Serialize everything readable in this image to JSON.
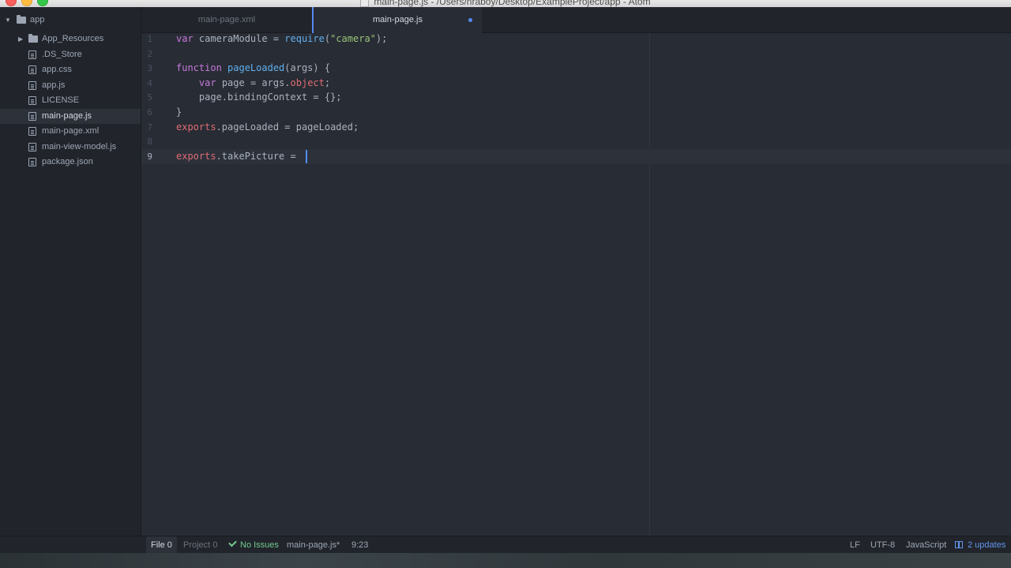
{
  "window": {
    "title": "main-page.js - /Users/nraboy/Desktop/ExampleProject/app - Atom"
  },
  "tree": {
    "root_label": "app",
    "items": [
      {
        "label": "App_Resources",
        "type": "folder"
      },
      {
        "label": ".DS_Store",
        "type": "file"
      },
      {
        "label": "app.css",
        "type": "file"
      },
      {
        "label": "app.js",
        "type": "file"
      },
      {
        "label": "LICENSE",
        "type": "file"
      },
      {
        "label": "main-page.js",
        "type": "file",
        "selected": true
      },
      {
        "label": "main-page.xml",
        "type": "file"
      },
      {
        "label": "main-view-model.js",
        "type": "file"
      },
      {
        "label": "package.json",
        "type": "file"
      }
    ]
  },
  "tabs": [
    {
      "label": "main-page.xml",
      "active": false
    },
    {
      "label": "main-page.js",
      "active": true,
      "modified": true
    }
  ],
  "editor": {
    "line_numbers": [
      "1",
      "2",
      "3",
      "4",
      "5",
      "6",
      "7",
      "8",
      "9"
    ],
    "current_line": "9",
    "lines": [
      [
        {
          "t": "var",
          "c": "kw"
        },
        {
          "t": " cameraModule = ",
          "c": "plain"
        },
        {
          "t": "require",
          "c": "fn"
        },
        {
          "t": "(",
          "c": "plain"
        },
        {
          "t": "\"camera\"",
          "c": "str"
        },
        {
          "t": ");",
          "c": "plain"
        }
      ],
      [],
      [
        {
          "t": "function",
          "c": "kw"
        },
        {
          "t": " ",
          "c": "plain"
        },
        {
          "t": "pageLoaded",
          "c": "fn"
        },
        {
          "t": "(args) {",
          "c": "plain"
        }
      ],
      [
        {
          "t": "    ",
          "c": "plain"
        },
        {
          "t": "var",
          "c": "kw"
        },
        {
          "t": " page = args.",
          "c": "plain"
        },
        {
          "t": "object",
          "c": "obj"
        },
        {
          "t": ";",
          "c": "plain"
        }
      ],
      [
        {
          "t": "    page.bindingContext = {};",
          "c": "plain"
        }
      ],
      [
        {
          "t": "}",
          "c": "plain"
        }
      ],
      [
        {
          "t": "exports",
          "c": "obj"
        },
        {
          "t": ".pageLoaded = pageLoaded;",
          "c": "plain"
        }
      ],
      [],
      [
        {
          "t": "exports",
          "c": "obj"
        },
        {
          "t": ".takePicture = ",
          "c": "plain"
        }
      ]
    ]
  },
  "statusbar": {
    "file_label": "File",
    "file_count": "0",
    "project_label": "Project",
    "project_count": "0",
    "issues": "No Issues",
    "filename": "main-page.js*",
    "cursor_pos": "9:23",
    "line_ending": "LF",
    "encoding": "UTF-8",
    "grammar": "JavaScript",
    "updates": "2 updates"
  },
  "colors": {
    "accent": "#568af2",
    "keyword": "#c678dd",
    "function": "#61afef",
    "string": "#98c379",
    "object": "#e06c75"
  }
}
